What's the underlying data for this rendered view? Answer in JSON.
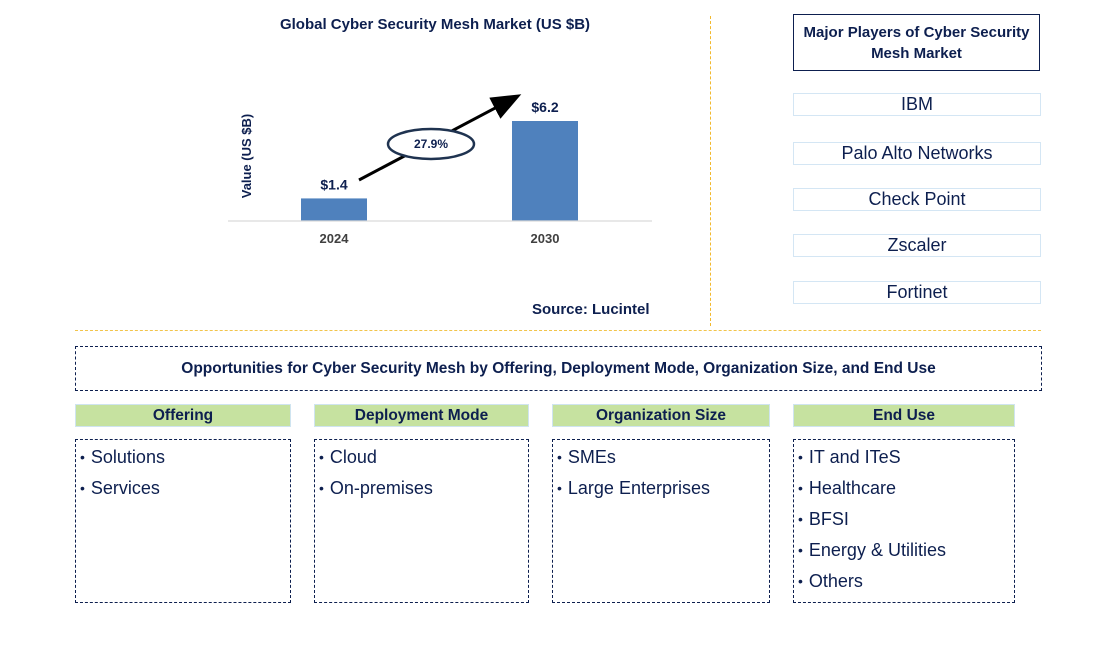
{
  "chart_data": {
    "type": "bar",
    "title": "Global Cyber Security Mesh Market (US $B)",
    "categories": [
      "2024",
      "2030"
    ],
    "values": [
      1.4,
      6.2
    ],
    "value_labels": [
      "$1.4",
      "$6.2"
    ],
    "xlabel": "",
    "ylabel": "Value (US $B)",
    "ylim": [
      0,
      6.2
    ],
    "grid": false,
    "bar_color": "#4f81bd",
    "annotation": {
      "text": "27.9%",
      "type": "CAGR arrow"
    },
    "source": "Source: Lucintel"
  },
  "players": {
    "title": "Major Players of Cyber Security Mesh Market",
    "items": [
      "IBM",
      "Palo Alto Networks",
      "Check Point",
      "Zscaler",
      "Fortinet"
    ]
  },
  "opportunities": {
    "title": "Opportunities for Cyber Security Mesh by Offering, Deployment Mode, Organization Size, and End Use",
    "segments": [
      {
        "name": "Offering",
        "items": [
          "Solutions",
          "Services"
        ]
      },
      {
        "name": "Deployment Mode",
        "items": [
          "Cloud",
          "On-premises"
        ]
      },
      {
        "name": "Organization Size",
        "items": [
          "SMEs",
          "Large Enterprises"
        ]
      },
      {
        "name": "End Use",
        "items": [
          "IT and ITeS",
          "Healthcare",
          "BFSI",
          "Energy & Utilities",
          "Others"
        ]
      }
    ]
  },
  "colors": {
    "text": "#0d1f4f",
    "bar": "#4f81bd",
    "segment_header": "#c6e2a0",
    "divider": "#f2b92d"
  }
}
